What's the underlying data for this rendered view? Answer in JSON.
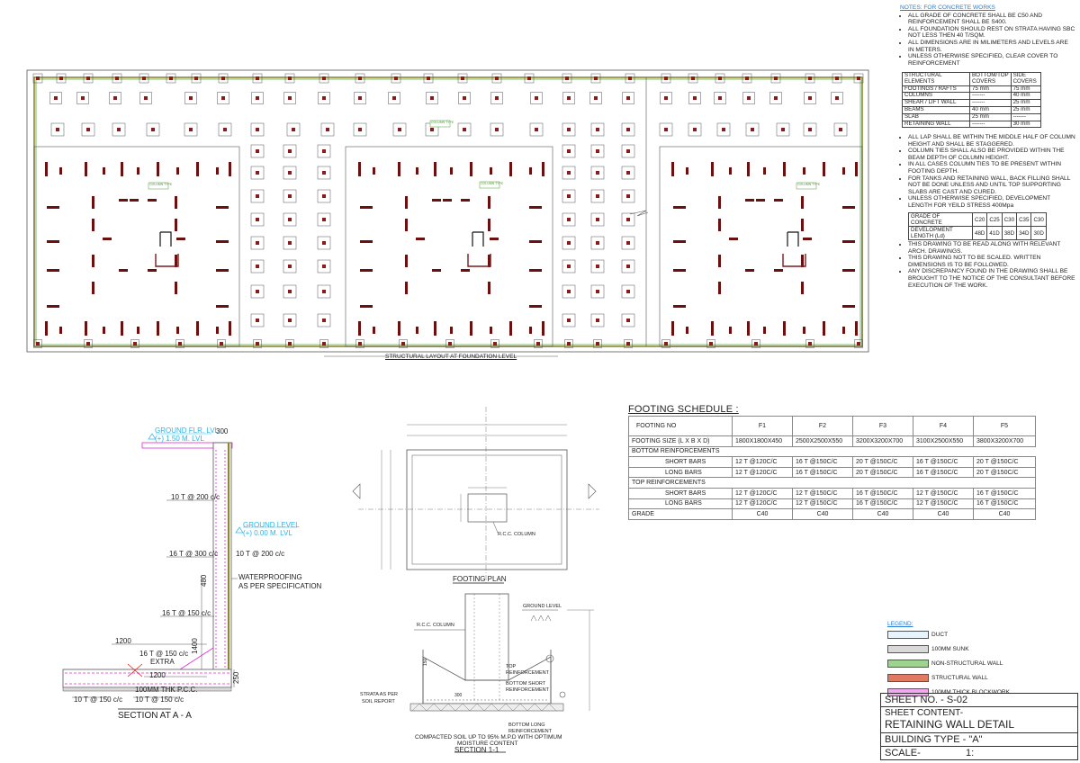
{
  "plan": {
    "title": "STRUCTURAL LAYOUT AT  FOUNDATION LEVEL",
    "column_tags": [
      "COLUMN TYPE",
      "COLUMN TYPE",
      "COLUMN TYPE",
      "COLUMN TYPE"
    ]
  },
  "notes": {
    "heading": "NOTES: FOR CONCRETE WORKS",
    "items_top": [
      "ALL GRADE OF CONCRETE SHALL BE C50  AND REINFORCEMENT SHALL BE S400.",
      "ALL FOUNDATION SHOULD REST ON STRATA HAVING SBC NOT LESS THEN 40 T/SQM.",
      "ALL DIMENSIONS ARE IN MILIMETERS AND LEVELS ARE IN METERS.",
      "UNLESS OTHERWISE SPECIFIED, CLEAR COVER TO REINFORCEMENT"
    ],
    "cover_table": {
      "headers": [
        "STRUCTURAL ELEMENTS",
        "BOTTOM/TOP COVERS",
        "SIDE COVERS"
      ],
      "rows": [
        [
          "FOOTINGS / RAFTS",
          "75 mm",
          "75 mm"
        ],
        [
          "COLUMNS",
          "-------",
          "40 mm"
        ],
        [
          "SHEAR / LIFT WALL",
          "-------",
          "25 mm"
        ],
        [
          "BEAMS",
          "40 mm",
          "25 mm"
        ],
        [
          "SLAB",
          "25 mm",
          "-------"
        ],
        [
          "RETAINING WALL",
          "-------",
          "30 mm"
        ]
      ]
    },
    "items_mid": [
      "ALL LAP SHALL BE WITHIN THE MIDDLE HALF OF COLUMN HEIGHT AND SHALL BE STAGGERED.",
      "COLUMN TIES SHALL ALSO BE PROVIDED WITHIN THE BEAM DEPTH OF COLUMN HEIGHT.",
      "IN ALL CASES COLUMN TIES TO BE PRESENT WITHIN FOOTING DEPTH.",
      "FOR TANKS AND RETAINING WALL, BACK FILLING SHALL NOT BE DONE UNLESS AND UNTIL TOP SUPPORTING SLABS ARE CAST AND CURED.",
      "UNLESS OTHERWISE SPECIFIED, DEVELOPMENT LENGTH FOR YEILD STRESS 400Mpa"
    ],
    "grade_table": {
      "row1": [
        "GRADE OF CONCRETE",
        "C20",
        "C25",
        "C30",
        "C35",
        "C30"
      ],
      "row2": [
        "DEVELOPMENT LENGTH (Ld)",
        "48D",
        "41D",
        "38D",
        "34D",
        "30D"
      ]
    },
    "items_bottom": [
      "THIS DRAWING TO BE READ ALONG WITH RELEVANT ARCH. DRAWINGS.",
      "THIS DRAWING NOT TO BE SCALED. WRITTEN DIMENSIONS IS TO BE FOLLOWED.",
      "ANY DISCREPANCY FOUND IN THE DRAWING SHALL BE BROUGHT TO THE NOTICE OF THE CONSULTANT BEFORE EXECUTION OF THE WORK."
    ]
  },
  "section_aa": {
    "title": "SECTION AT A - A",
    "ground_flr_1": "GROUND FLR. LVL",
    "ground_flr_2": "(+) 1.50 M. LVL",
    "dim_300": "300",
    "bar1": "10 T @ 200 c/c",
    "ground_lvl_1": "GROUND LEVEL",
    "ground_lvl_2": "(+) 0.00 M. LVL",
    "bar2_left": "16 T @ 300 c/c",
    "bar2_right": "10 T @ 200 c/c",
    "wp_1": "WATERPROOFING",
    "wp_2": "AS PER SPECIFICATION",
    "dim_480": "480",
    "bar3": "16 T @ 150 c/c",
    "dim_1400": "1400",
    "dim_1200a": "1200",
    "bar4": "16 T @ 150 c/c",
    "extra": "EXTRA",
    "dim_1200b": "1200",
    "dim_250": "250",
    "pcc": "100MM THK P.C.C.",
    "bot1": "10 T @ 150 c/c",
    "bot2": "10 T @ 150 c/c"
  },
  "footing_plan": {
    "title": "FOOTING PLAN",
    "col_label": "R.C.C. COLUMN"
  },
  "section_11": {
    "title": "SECTION 1-1",
    "ground": "GROUND LEVEL",
    "col": "R.C.C. COLUMN",
    "top_r1": "TOP",
    "top_r2": "REINFORCEMENT",
    "bs_1": "BOTTOM SHORT",
    "bs_2": "REINFORCEMENT",
    "strata_1": "STRATA AS PER",
    "strata_2": "SOIL REPORT",
    "bl_1": "BOTTOM LONG",
    "bl_2": "REINFORCEMENT",
    "compact_1": "COMPACTED SOIL UP TO 95% M.P.D WITH OPTIMUM",
    "compact_2": "MOISTURE CONTENT",
    "d150": "150",
    "d300": "300"
  },
  "footing_schedule": {
    "title": "FOOTING SCHEDULE :",
    "header": [
      "FOOTING NO",
      "F1",
      "F2",
      "F3",
      "F4",
      "F5"
    ],
    "size": [
      "FOOTING SIZE (L X B X D)",
      "1800X1800X450",
      "2500X2500X550",
      "3200X3200X700",
      "3100X2500X550",
      "3800X3200X700"
    ],
    "bottom_label": "BOTTOM REINFORCEMENTS",
    "bottom_short": [
      "SHORT BARS",
      "12 T @120C/C",
      "16 T @150C/C",
      "20 T @150C/C",
      "16 T @150C/C",
      "20 T @150C/C"
    ],
    "bottom_long": [
      "LONG BARS",
      "12 T @120C/C",
      "16 T @150C/C",
      "20 T @150C/C",
      "16 T @150C/C",
      "20 T @150C/C"
    ],
    "top_label": "TOP REINFORCEMENTS",
    "top_short": [
      "SHORT BARS",
      "12 T @120C/C",
      "12 T @150C/C",
      "16 T @150C/C",
      "12 T @150C/C",
      "16 T @150C/C"
    ],
    "top_long": [
      "LONG BARS",
      "12 T @120C/C",
      "12 T @150C/C",
      "16 T @150C/C",
      "12 T @150C/C",
      "16 T @150C/C"
    ],
    "grade": [
      "GRADE",
      "C40",
      "C40",
      "C40",
      "C40",
      "C40"
    ]
  },
  "legend": {
    "heading": "LEGEND:",
    "items": [
      {
        "label": "DUCT",
        "color": "#e8f4fb"
      },
      {
        "label": "100MM SUNK",
        "color": "#d9d9d9"
      },
      {
        "label": "NON-STRUCTURAL WALL",
        "color": "#9ed48f"
      },
      {
        "label": "STRUCTURAL WALL",
        "color": "#e07a63"
      },
      {
        "label": "100MM THICK BLOCKWORK",
        "color": "#f1a8ec"
      }
    ]
  },
  "title_block": {
    "sheet_no": "SHEET NO. - S-02",
    "content_label": "SHEET CONTENT-",
    "content": "RETAINING WALL DETAIL",
    "building": "BUILDING TYPE -   \"A\"",
    "scale": "SCALE-",
    "scale_val": "1:"
  }
}
